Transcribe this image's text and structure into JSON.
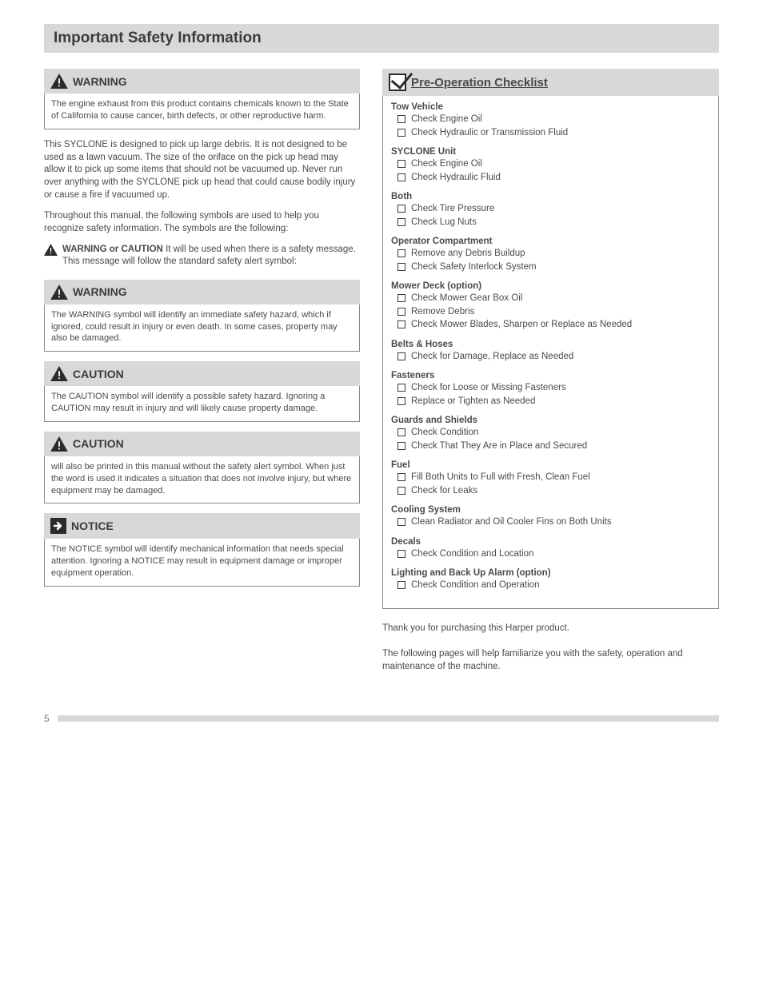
{
  "header": {
    "title": "Important Safety Information"
  },
  "left": {
    "box1": {
      "title": "WARNING",
      "body": "The engine exhaust from this product contains chemicals known to the State of California to cause cancer, birth defects, or other reproductive harm."
    },
    "para1": "This SYCLONE is designed to pick up large debris. It is not designed to be used as a lawn vacuum. The size of the oriface on the pick up head may allow it to pick up some items that should not be vacuumed up. Never run over anything with the SYCLONE pick up head that could cause bodily injury or cause a fire if vacuumed up.",
    "para2": "Throughout this manual, the following symbols are used to help you recognize safety information. The symbols are the following:",
    "inline": {
      "label": "WARNING or CAUTION",
      "text": "It will be used when there is a safety message. This message will follow the standard safety alert symbol:"
    },
    "box2": {
      "title": "WARNING",
      "body": "The WARNING symbol will identify an immediate safety hazard, which if ignored, could result in injury or even death. In some cases, property may also be damaged."
    },
    "box3": {
      "title": "CAUTION",
      "body": "The CAUTION symbol will identify a possible safety hazard. Ignoring a CAUTION may result in injury and will likely cause property damage."
    },
    "box4": {
      "title": "CAUTION",
      "body": "will also be printed in this manual without the safety alert symbol. When just the word is used it indicates a situation that does not involve injury, but where equipment may be damaged."
    },
    "box5": {
      "title": "NOTICE",
      "body": "The NOTICE symbol will identify mechanical information that needs special attention. Ignoring a NOTICE may result in equipment damage or improper equipment operation."
    }
  },
  "right": {
    "checklist_title": "Pre-Operation Checklist",
    "groups": [
      {
        "title": "Tow Vehicle",
        "items": [
          "Check Engine Oil",
          "Check Hydraulic or Transmission Fluid"
        ]
      },
      {
        "title": "SYCLONE Unit",
        "items": [
          "Check Engine Oil",
          "Check Hydraulic Fluid"
        ]
      },
      {
        "title": "Both",
        "items": [
          "Check Tire Pressure",
          "Check Lug Nuts"
        ]
      },
      {
        "title": "Operator Compartment",
        "items": [
          "Remove any Debris Buildup",
          "Check Safety Interlock System"
        ]
      },
      {
        "title": "Mower Deck (option)",
        "items": [
          "Check Mower Gear Box Oil",
          "Remove Debris",
          "Check Mower Blades, Sharpen or Replace as Needed"
        ]
      },
      {
        "title": "Belts & Hoses",
        "items": [
          "Check for Damage, Replace as Needed"
        ]
      },
      {
        "title": "Fasteners",
        "items": [
          "Check for Loose or Missing Fasteners",
          "Replace or Tighten as Needed"
        ]
      },
      {
        "title": "Guards and Shields",
        "items": [
          "Check Condition",
          "Check That They Are in Place and Secured"
        ]
      },
      {
        "title": "Fuel",
        "items": [
          "Fill Both Units to Full with Fresh, Clean Fuel",
          "Check for Leaks"
        ]
      },
      {
        "title": "Cooling System",
        "items": [
          "Clean Radiator and Oil Cooler Fins on Both Units"
        ]
      },
      {
        "title": "Decals",
        "items": [
          "Check Condition and Location"
        ]
      },
      {
        "title": "Lighting and Back Up Alarm (option)",
        "items": [
          "Check Condition and Operation"
        ]
      }
    ],
    "thanks": "Thank you for purchasing this Harper product.",
    "thanks2": "The following pages will help familiarize you with the safety, operation and maintenance of the machine."
  },
  "footer": {
    "page": "5"
  }
}
